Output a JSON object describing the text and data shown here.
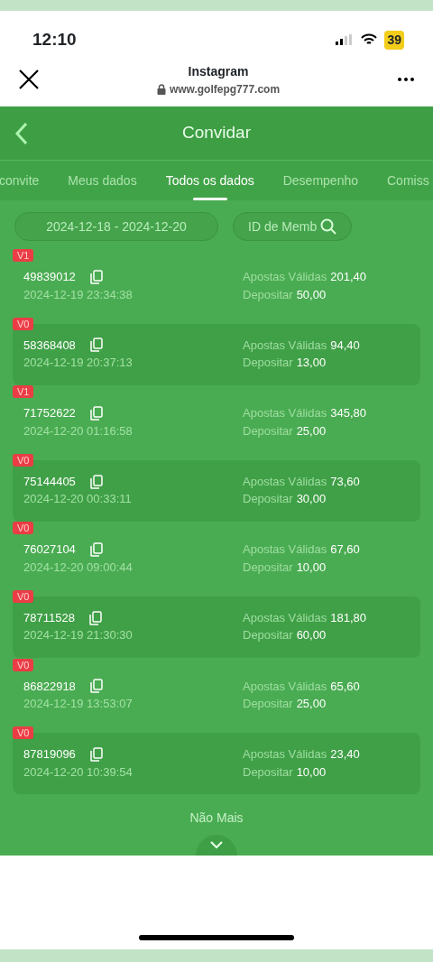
{
  "status_bar": {
    "time": "12:10",
    "battery": "39"
  },
  "browser": {
    "title": "Instagram",
    "url": "www.golfepg777.com"
  },
  "header": {
    "title": "Convidar"
  },
  "tabs": [
    {
      "label": "convite",
      "selected": false
    },
    {
      "label": "Meus dados",
      "selected": false
    },
    {
      "label": "Todos os dados",
      "selected": true
    },
    {
      "label": "Desempenho",
      "selected": false
    },
    {
      "label": "Comiss",
      "selected": false
    }
  ],
  "filters": {
    "date_range": "2024-12-18 - 2024-12-20",
    "search": {
      "placeholder": "ID de Memb"
    }
  },
  "members": [
    {
      "level": "V1",
      "id": "49839012",
      "time": "2024-12-19 23:34:38",
      "bets_label": "Apostas Válidas",
      "bets": "201,40",
      "deposit_label": "Depositar",
      "deposit": "50,00"
    },
    {
      "level": "V0",
      "id": "58368408",
      "time": "2024-12-19 20:37:13",
      "bets_label": "Apostas Válidas",
      "bets": "94,40",
      "deposit_label": "Depositar",
      "deposit": "13,00"
    },
    {
      "level": "V1",
      "id": "71752622",
      "time": "2024-12-20 01:16:58",
      "bets_label": "Apostas Válidas",
      "bets": "345,80",
      "deposit_label": "Depositar",
      "deposit": "25,00"
    },
    {
      "level": "V0",
      "id": "75144405",
      "time": "2024-12-20 00:33:11",
      "bets_label": "Apostas Válidas",
      "bets": "73,60",
      "deposit_label": "Depositar",
      "deposit": "30,00"
    },
    {
      "level": "V0",
      "id": "76027104",
      "time": "2024-12-20 09:00:44",
      "bets_label": "Apostas Válidas",
      "bets": "67,60",
      "deposit_label": "Depositar",
      "deposit": "10,00"
    },
    {
      "level": "V0",
      "id": "78711528",
      "time": "2024-12-19 21:30:30",
      "bets_label": "Apostas Válidas",
      "bets": "181,80",
      "deposit_label": "Depositar",
      "deposit": "60,00"
    },
    {
      "level": "V0",
      "id": "86822918",
      "time": "2024-12-19 13:53:07",
      "bets_label": "Apostas Válidas",
      "bets": "65,60",
      "deposit_label": "Depositar",
      "deposit": "25,00"
    },
    {
      "level": "V0",
      "id": "87819096",
      "time": "2024-12-20 10:39:54",
      "bets_label": "Apostas Válidas",
      "bets": "23,40",
      "deposit_label": "Depositar",
      "deposit": "10,00"
    }
  ],
  "footer_text": "Não Mais"
}
